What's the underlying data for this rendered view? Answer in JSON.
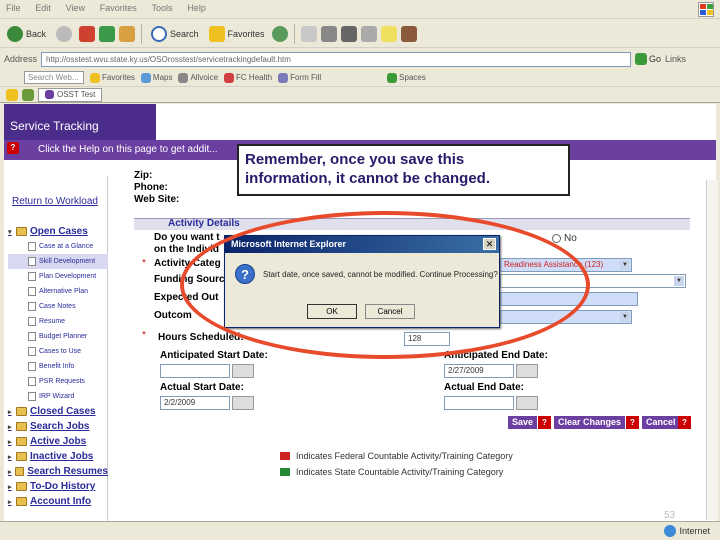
{
  "browser": {
    "menu": [
      "File",
      "Edit",
      "View",
      "Favorites",
      "Tools",
      "Help"
    ],
    "toolbar": {
      "back": "Back",
      "search": "Search",
      "favorites": "Favorites"
    },
    "address": {
      "label": "Address",
      "url": "http://osstest.wvu.state.ky.us/OSOrosstest/servicetrackingdefault.htm",
      "go": "Go",
      "links": "Links"
    },
    "links_bar": {
      "search_placeholder": "Search Web...",
      "favorites": "Favorites",
      "maps": "Maps",
      "allvoice": "Allvoice",
      "health": "FC Health",
      "formfill": "Form Fill",
      "spaces": "Spaces"
    },
    "tab": "OSST Test",
    "status": {
      "zone": "Internet"
    }
  },
  "page": {
    "banner_title": "Service Tracking",
    "help_text": "Click the Help on this page to get addit...",
    "return_link": "Return to Workload",
    "contact": {
      "zip": "Zip:",
      "phone": "Phone:",
      "website": "Web Site:"
    },
    "section_title": "Activity Details",
    "fields": {
      "do_you_want": "Do you want t",
      "on_the_indiv": "on the Individ",
      "no_label": "No",
      "activity_category": "Activity Categ",
      "activity_value": "Readiness Assistance (123)",
      "funding_source": "Funding Sourc",
      "expected_out": "Expected Out",
      "outcome": "Outcom",
      "hours_scheduled": "Hours Scheduled:",
      "hours_value": "128",
      "anticipated_start": "Anticipated Start Date:",
      "anticipated_end": "Anticipated End Date:",
      "anticipated_end_value": "2/27/2009",
      "actual_start": "Actual Start Date:",
      "actual_start_value": "2/2/2009",
      "actual_end": "Actual End Date:"
    },
    "buttons": {
      "save": "Save",
      "clear": "Clear Changes",
      "cancel": "Cancel"
    },
    "legend": [
      {
        "color": "#cc2222",
        "text": "Indicates Federal Countable Activity/Training Category"
      },
      {
        "color": "#228833",
        "text": "Indicates State Countable Activity/Training Category"
      }
    ],
    "tree": [
      {
        "label": "Open Cases",
        "level": 0,
        "bold": true
      },
      {
        "label": "Case at a Glance",
        "level": 1
      },
      {
        "label": "Skill Development",
        "level": 1,
        "selected": true
      },
      {
        "label": "Plan Development",
        "level": 1
      },
      {
        "label": "Alternative Plan",
        "level": 1
      },
      {
        "label": "Case Notes",
        "level": 1
      },
      {
        "label": "Resume",
        "level": 1
      },
      {
        "label": "Budget Planner",
        "level": 1
      },
      {
        "label": "Cases to Use",
        "level": 1
      },
      {
        "label": "Benefit Info",
        "level": 1
      },
      {
        "label": "PSR Requests",
        "level": 1
      },
      {
        "label": "IRP Wizard",
        "level": 1
      },
      {
        "label": "Closed Cases",
        "level": 0,
        "bold": true
      },
      {
        "label": "Search Jobs",
        "level": 0,
        "bold": true
      },
      {
        "label": "Active Jobs",
        "level": 0,
        "bold": true
      },
      {
        "label": "Inactive Jobs",
        "level": 0,
        "bold": true
      },
      {
        "label": "Search Resumes",
        "level": 0,
        "bold": true
      },
      {
        "label": "To-Do History",
        "level": 0,
        "bold": true
      },
      {
        "label": "Account Info",
        "level": 0,
        "bold": true
      }
    ]
  },
  "callout": {
    "line1": "Remember, once you save this",
    "line2": "information, it cannot be changed."
  },
  "dialog": {
    "title": "Microsoft Internet Explorer",
    "message": "Start date, once saved, cannot be modified. Continue Processing?",
    "ok": "OK",
    "cancel": "Cancel"
  },
  "slide_number": "53",
  "colors": {
    "accent_purple": "#6b3fa0",
    "banner_purple": "#4b2c8a",
    "ellipse": "#e84a2c"
  }
}
